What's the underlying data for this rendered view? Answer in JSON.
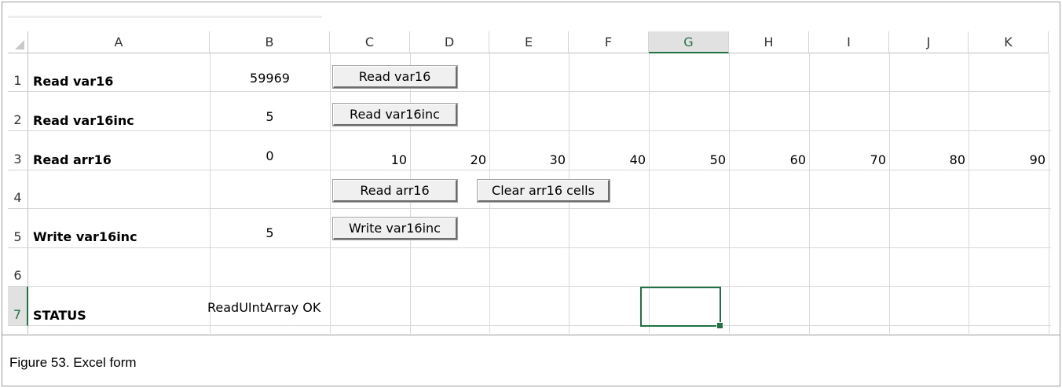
{
  "columns": [
    "A",
    "B",
    "C",
    "D",
    "E",
    "F",
    "G",
    "H",
    "I",
    "J",
    "K"
  ],
  "active_column": "G",
  "rows": [
    "1",
    "2",
    "3",
    "4",
    "5",
    "6",
    "7"
  ],
  "active_row": "7",
  "cells": {
    "A1": "Read var16",
    "B1": "59969",
    "A2": "Read var16inc",
    "B2": "5",
    "A3": "Read arr16",
    "B3": "0",
    "C3": "10",
    "D3": "20",
    "E3": "30",
    "F3": "40",
    "G3": "50",
    "H3": "60",
    "I3": "70",
    "J3": "80",
    "K3": "90",
    "A5": "Write var16inc",
    "B5": "5",
    "A7": "STATUS",
    "B7": "ReadUIntArray OK"
  },
  "buttons": {
    "read_var16": "Read var16",
    "read_var16inc": "Read var16inc",
    "read_arr16": "Read arr16",
    "clear_arr16": "Clear arr16 cells",
    "write_var16inc": "Write var16inc"
  },
  "selected_cell": "G7",
  "caption": "Figure 53.  Excel form",
  "colors": {
    "excel_green": "#217346",
    "gridline": "#d9d9d9",
    "header_bg": "#e1e1e1"
  }
}
